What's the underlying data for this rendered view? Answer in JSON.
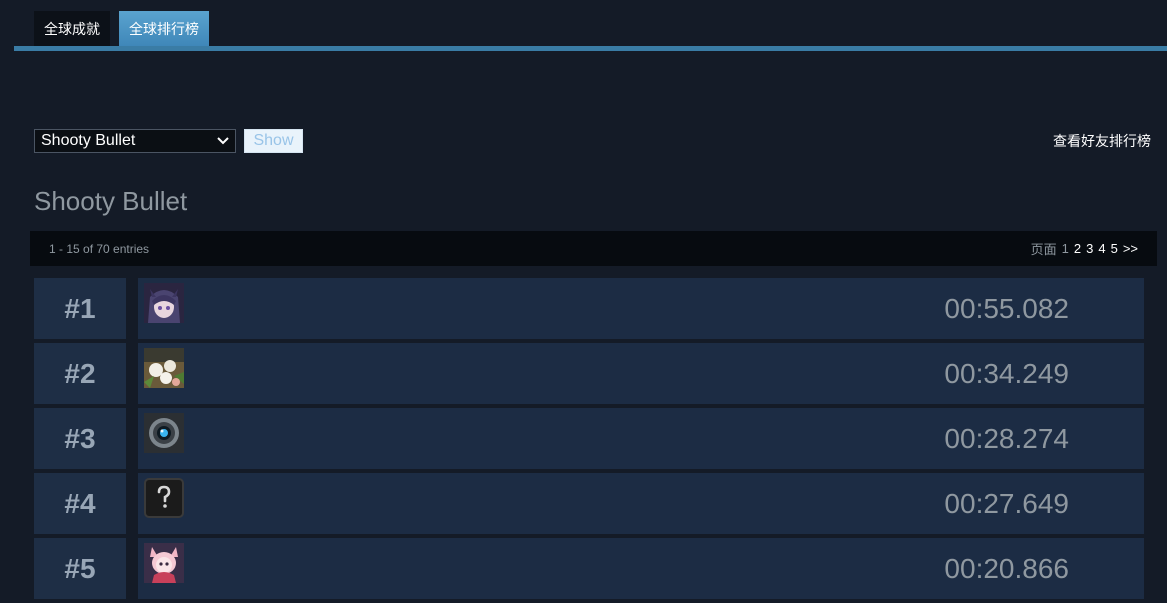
{
  "tabs": [
    {
      "label": "全球成就"
    },
    {
      "label": "全球排行榜"
    }
  ],
  "controls": {
    "leaderboard_selected": "Shooty Bullet",
    "show_label": "Show"
  },
  "friends_link": "查看好友排行榜",
  "board_title": "Shooty Bullet",
  "pager": {
    "entries_text": "1 - 15 of 70 entries",
    "page_label": "页面",
    "current_page": "1",
    "pages": [
      "2",
      "3",
      "4",
      "5"
    ],
    "next": ">>"
  },
  "rows": [
    {
      "rank": "#1",
      "score": "00:55.082",
      "avatar_icon": "anime-girl-avatar-icon"
    },
    {
      "rank": "#2",
      "score": "00:34.249",
      "avatar_icon": "flowers-avatar-icon"
    },
    {
      "rank": "#3",
      "score": "00:28.274",
      "avatar_icon": "robot-eye-avatar-icon"
    },
    {
      "rank": "#4",
      "score": "00:27.649",
      "avatar_icon": "question-mark-avatar-icon"
    },
    {
      "rank": "#5",
      "score": "00:20.866",
      "avatar_icon": "cat-girl-avatar-icon"
    }
  ],
  "colors": {
    "background": "#141b27",
    "tab_active": "#4a95c4",
    "row_bg": "#1c2c44",
    "rank_bg": "#1e2e45"
  }
}
